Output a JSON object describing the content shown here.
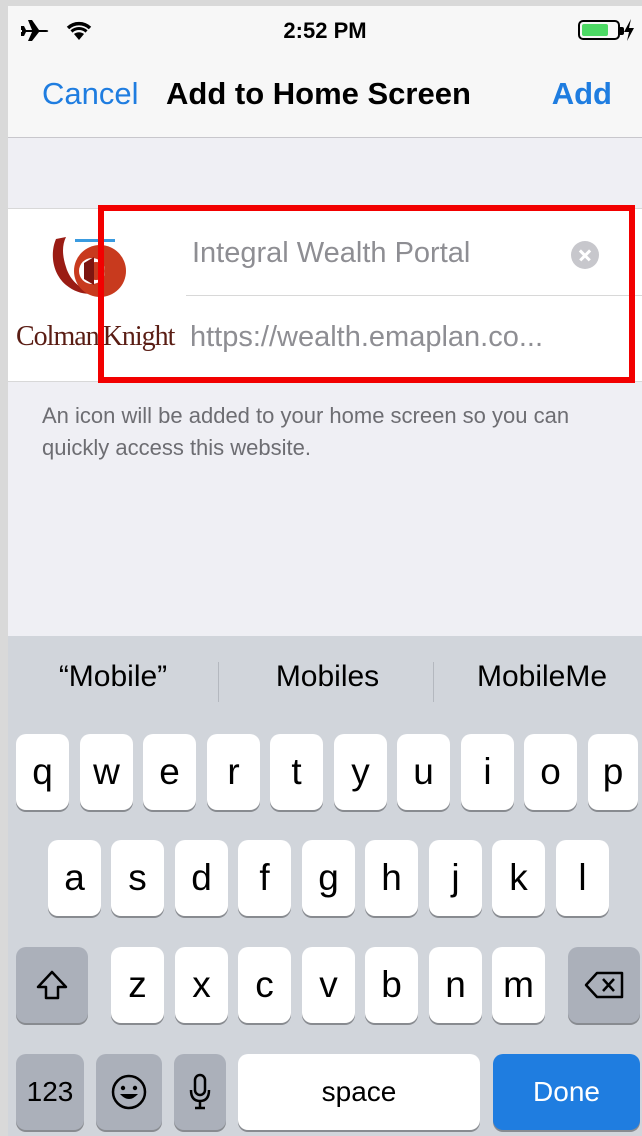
{
  "status_bar": {
    "time": "2:52 PM",
    "battery_color": "#4cd964"
  },
  "nav": {
    "cancel_label": "Cancel",
    "title": "Add to Home Screen",
    "add_label": "Add",
    "accent_color": "#1f7de0"
  },
  "bookmark": {
    "logo_text_left": "Colman",
    "logo_text_right": "Knight",
    "name_value": "Integral Wealth Portal",
    "url_value": "https://wealth.emaplan.co...",
    "highlight_color": "#f20000"
  },
  "hint_text": "An icon will be added to your home screen so you can quickly access this website.",
  "keyboard": {
    "suggestions": [
      "“Mobile”",
      "Mobiles",
      "MobileMe"
    ],
    "row1": [
      "q",
      "w",
      "e",
      "r",
      "t",
      "y",
      "u",
      "i",
      "o",
      "p"
    ],
    "row2": [
      "a",
      "s",
      "d",
      "f",
      "g",
      "h",
      "j",
      "k",
      "l"
    ],
    "row3": [
      "z",
      "x",
      "c",
      "v",
      "b",
      "n",
      "m"
    ],
    "numbers_label": "123",
    "space_label": "space",
    "done_label": "Done"
  }
}
